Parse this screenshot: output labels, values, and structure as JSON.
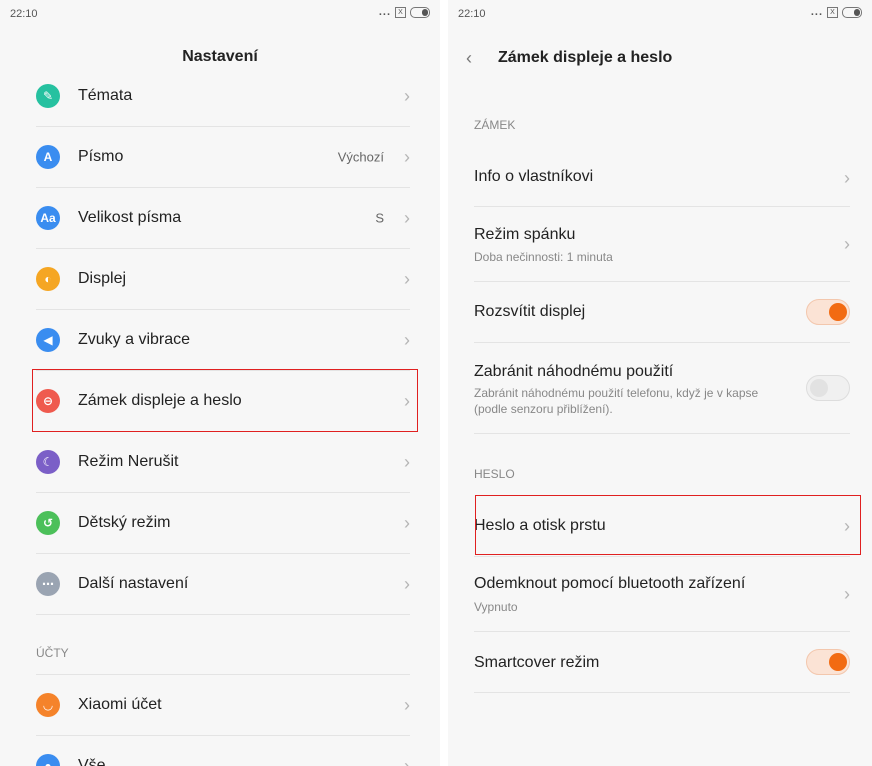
{
  "left": {
    "status": {
      "time": "22:10",
      "dots": "...",
      "box": "X"
    },
    "header": {
      "title": "Nastavení"
    },
    "items": [
      {
        "label": "Témata",
        "icon": "brush-icon",
        "glyph": "✎",
        "color": "#26c1a0"
      },
      {
        "label": "Písmo",
        "value": "Výchozí",
        "icon": "font-icon",
        "glyph": "A",
        "color": "#3a8df0"
      },
      {
        "label": "Velikost písma",
        "value": "S",
        "icon": "font-size-icon",
        "glyph": "Aa",
        "color": "#3a8df0"
      },
      {
        "label": "Displej",
        "icon": "display-icon",
        "glyph": "◐",
        "color": "#f5a623"
      },
      {
        "label": "Zvuky a vibrace",
        "icon": "speaker-icon",
        "glyph": "◀",
        "color": "#3a8df0"
      },
      {
        "label": "Zámek displeje a heslo",
        "icon": "lock-icon",
        "glyph": "⊖",
        "color": "#ef5a4e"
      },
      {
        "label": "Režim Nerušit",
        "icon": "moon-icon",
        "glyph": "☾",
        "color": "#7b5fc7"
      },
      {
        "label": "Dětský režim",
        "icon": "child-icon",
        "glyph": "↺",
        "color": "#4cc05a"
      },
      {
        "label": "Další nastavení",
        "icon": "more-icon",
        "glyph": "⋯",
        "color": "#9aa4b2"
      }
    ],
    "section_accounts": "ÚČTY",
    "accounts": [
      {
        "label": "Xiaomi účet",
        "icon": "mi-account-icon",
        "glyph": "◡",
        "color": "#f5832a"
      },
      {
        "label": "Vše",
        "icon": "all-accounts-icon",
        "glyph": "●",
        "color": "#3a8df0"
      }
    ],
    "chevron": "›"
  },
  "right": {
    "status": {
      "time": "22:10",
      "dots": "...",
      "box": "X"
    },
    "header": {
      "title": "Zámek displeje a heslo",
      "back": "‹"
    },
    "section_lock": "ZÁMEK",
    "info": {
      "label": "Info o vlastníkovi"
    },
    "sleep": {
      "label": "Režim spánku",
      "sub": "Doba nečinnosti: 1 minuta"
    },
    "wake": {
      "label": "Rozsvítit displej",
      "on": true
    },
    "prevent": {
      "label": "Zabránit náhodnému použití",
      "sub": "Zabránit náhodnému použití telefonu, když je v kapse (podle senzoru přiblížení).",
      "on": false
    },
    "section_password": "HESLO",
    "password": {
      "label": "Heslo a otisk prstu"
    },
    "bluetooth": {
      "label": "Odemknout pomocí bluetooth zařízení",
      "sub": "Vypnuto"
    },
    "smartcover": {
      "label": "Smartcover režim",
      "on": true
    },
    "chevron": "›"
  }
}
